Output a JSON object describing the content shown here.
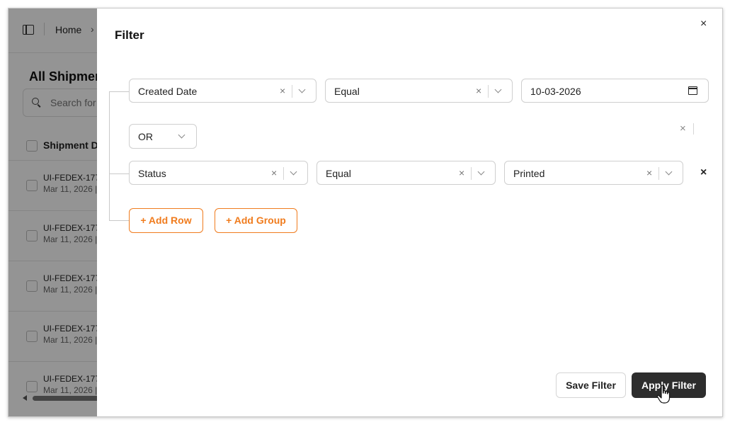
{
  "background": {
    "breadcrumb_home": "Home",
    "breadcrumb_chevron": "›",
    "page_title": "All Shipmen",
    "search_placeholder": "Search for",
    "column_header": "Shipment D",
    "rows": [
      {
        "id": "UI-FEDEX-177",
        "date": "Mar 11, 2026 |"
      },
      {
        "id": "UI-FEDEX-177",
        "date": "Mar 11, 2026 |"
      },
      {
        "id": "UI-FEDEX-177",
        "date": "Mar 11, 2026 |"
      },
      {
        "id": "UI-FEDEX-177",
        "date": "Mar 11, 2026 |"
      },
      {
        "id": "UI-FEDEX-177",
        "date": "Mar 11, 2026 |"
      }
    ]
  },
  "drawer": {
    "title": "Filter",
    "close_glyph": "×",
    "condition_1": {
      "field": "Created Date",
      "operator": "Equal",
      "value": "10-03-2026"
    },
    "group_operator": "OR",
    "condition_2": {
      "field": "Status",
      "operator": "Equal",
      "value": "Printed"
    },
    "add_row_label": "+ Add Row",
    "add_group_label": "+ Add Group",
    "save_label": "Save Filter",
    "apply_label": "Apply Filter",
    "clear_glyph": "×",
    "remove_glyph": "×"
  }
}
